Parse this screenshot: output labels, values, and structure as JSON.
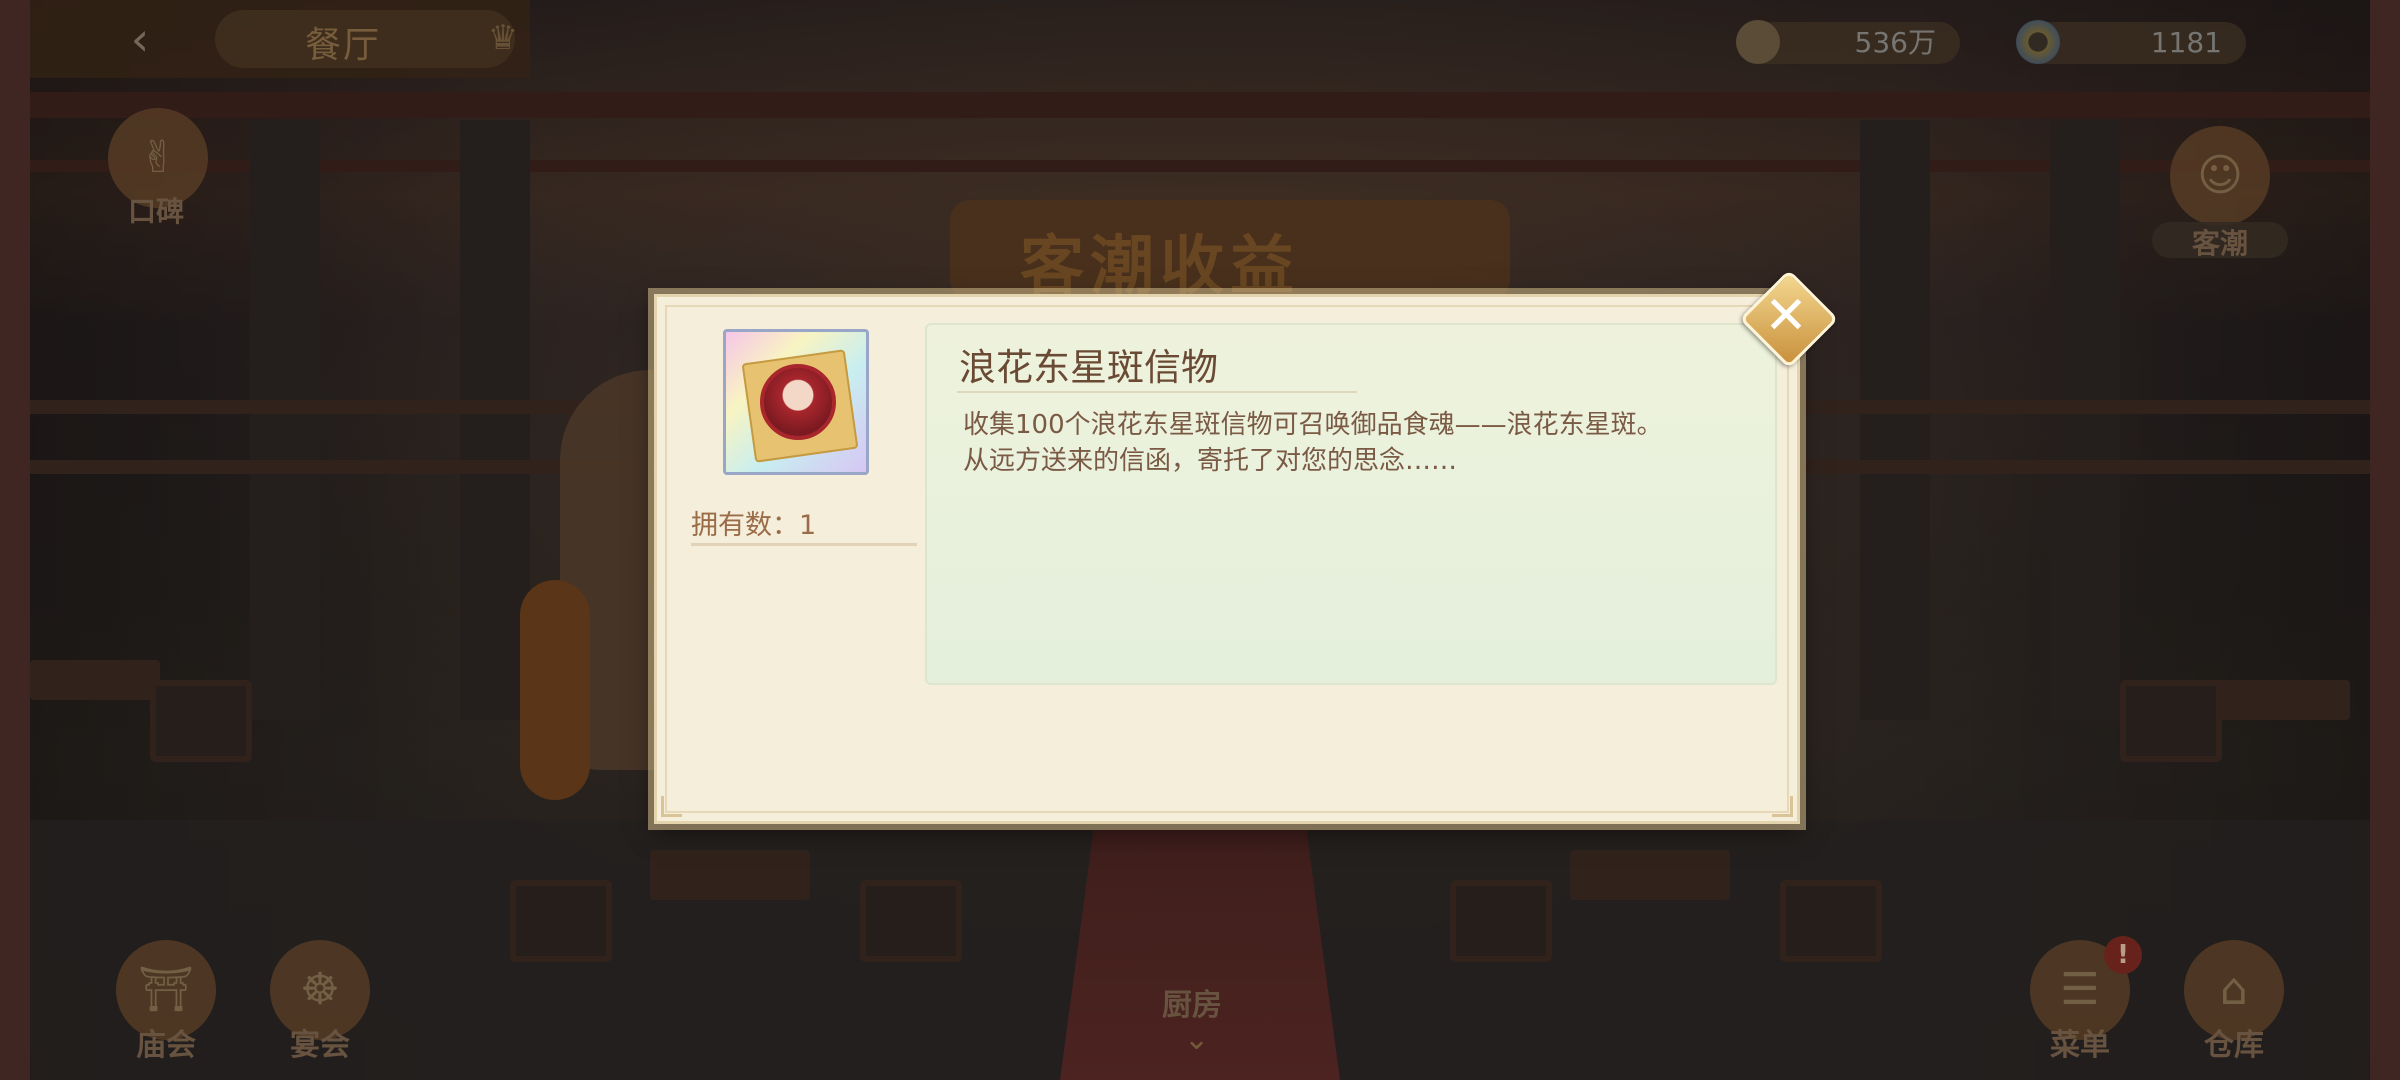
{
  "header": {
    "back_icon": "back-arrow-icon",
    "title": "餐厅",
    "crown_icon": "crown-icon"
  },
  "currency": {
    "coins": "536万",
    "gems": "1181"
  },
  "side_buttons": {
    "reputation": "口碑",
    "customers": "客潮"
  },
  "bottom_buttons": {
    "temple_fair": "庙会",
    "banquet": "宴会",
    "kitchen": "厨房",
    "menu": "菜单",
    "warehouse": "仓库",
    "alert": "!"
  },
  "background": {
    "banner": "客潮收益"
  },
  "modal": {
    "item_name": "浪花东星斑信物",
    "owned_label": "拥有数：1",
    "description": [
      "收集100个浪花东星斑信物可召唤御品食魂——浪花东星斑。",
      "从远方送来的信函，寄托了对您的思念……"
    ],
    "close_icon": "close-icon"
  },
  "colors": {
    "modal_bg": "#f4eedb",
    "panel_bg": "#e6f0dc",
    "title_text": "#6a4a34",
    "body_text": "#7a5a44",
    "close_gold": "#d8a850"
  }
}
